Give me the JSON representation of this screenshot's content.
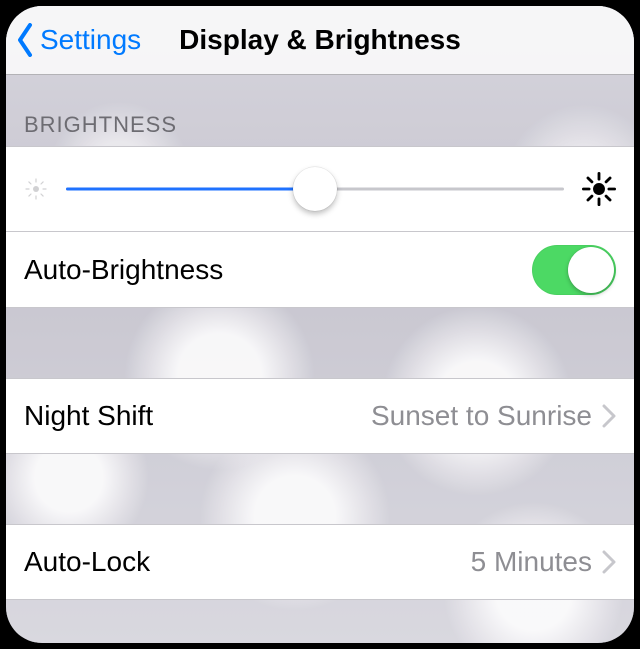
{
  "nav": {
    "back_label": "Settings",
    "title": "Display & Brightness"
  },
  "brightness": {
    "section_header": "BRIGHTNESS",
    "slider_percent": 50,
    "auto_label": "Auto-Brightness",
    "auto_on": true
  },
  "night_shift": {
    "label": "Night Shift",
    "value": "Sunset to Sunrise"
  },
  "auto_lock": {
    "label": "Auto-Lock",
    "value": "5 Minutes"
  },
  "colors": {
    "tint": "#007aff",
    "toggle_on": "#4cd964"
  }
}
